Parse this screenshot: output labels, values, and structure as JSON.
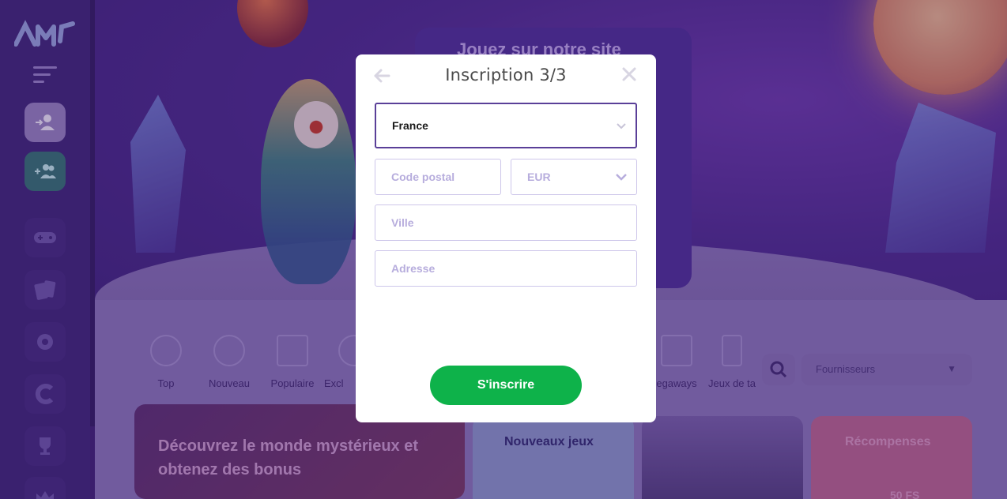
{
  "modal": {
    "title": "Inscription 3/3",
    "country": {
      "value": "France"
    },
    "postal_code": {
      "placeholder": "Code postal"
    },
    "currency": {
      "value": "EUR"
    },
    "city": {
      "placeholder": "Ville"
    },
    "address": {
      "placeholder": "Adresse"
    },
    "submit_label": "S'inscrire",
    "back_icon": "arrow-left-icon",
    "close_icon": "close-icon"
  },
  "background": {
    "promo_title": "Jouez sur notre site",
    "categories": [
      {
        "label": "Top"
      },
      {
        "label": "Nouveau"
      },
      {
        "label": "Populaire"
      },
      {
        "label": "Excl"
      },
      {
        "label": "egaways"
      },
      {
        "label": "Jeux de ta"
      }
    ],
    "providers_label": "Fournisseurs",
    "tiles": {
      "discover": "Découvrez le monde mystérieux et obtenez des bonus",
      "new_games": "Nouveaux jeux",
      "rewards": "Récompenses",
      "rewards_badge": "50 FS"
    }
  },
  "colors": {
    "accent_purple": "#5a3f98",
    "submit_green": "#0eb24a",
    "placeholder": "#b7addd",
    "sidebar": "#3a2470"
  }
}
